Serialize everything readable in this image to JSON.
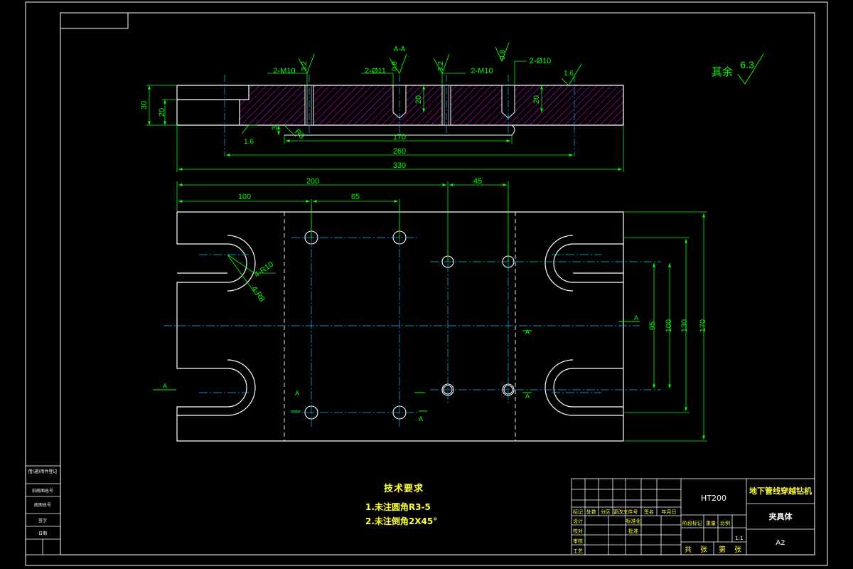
{
  "section_label": "A-A",
  "dims": {
    "d30": "30",
    "d20_left": "20",
    "d20_mid": "20",
    "d20_right": "20",
    "d3": "3",
    "d170_top": "170",
    "d260": "260",
    "d330": "330",
    "d200": "200",
    "d100": "100",
    "d65": "65",
    "d45": "45",
    "d95": "95",
    "d100v": "100",
    "d130": "130",
    "d170v": "170"
  },
  "callouts": {
    "m10_left": "2-M10",
    "d11": "2-Ø11",
    "m10_right": "2-M10",
    "d10": "2-Ø10",
    "r3": "R3",
    "r10": "4-R10",
    "r8": "4-R8"
  },
  "roughness": {
    "r32_left": "3.2",
    "r08_mid": "0.8",
    "r32_mid": "3.2",
    "r08_right": "0.8",
    "r16_top": "1.6",
    "r16_bottom": "1.6",
    "rest_label": "其余",
    "rest_value": "6.3"
  },
  "section_marks": [
    "A",
    "A",
    "A",
    "A",
    "A",
    "A"
  ],
  "tech_requirements": {
    "title": "技术要求",
    "items": [
      "1.未注圆角R3-5",
      "2.未注倒角2X45°"
    ]
  },
  "title_block": {
    "material": "HT200",
    "project": "地下管线穿越钻机",
    "part_name": "夹具体",
    "sheet": "A2",
    "scale": "1:1",
    "header_cells": [
      "标记",
      "处数",
      "分区",
      "更改文件号",
      "签名",
      "年月日"
    ],
    "row_labels": [
      "设计",
      "校对",
      "审核",
      "工艺"
    ],
    "mid_labels": [
      "标准化",
      "批准"
    ],
    "stage_labels": [
      "阶段标记",
      "重量",
      "比例"
    ],
    "sheets_text": [
      "共",
      "张",
      "第",
      "张"
    ]
  },
  "left_stamp": [
    "借(通)用件登记",
    "旧底图总号",
    "底图总号",
    "签字",
    "日期"
  ],
  "colors": {
    "frame": "#ffffff",
    "outline": "#ffffff",
    "dim": "#00ff00",
    "center": "#00c8ff",
    "hatch": "#ff00ff",
    "text_yellow": "#ffff3c"
  }
}
